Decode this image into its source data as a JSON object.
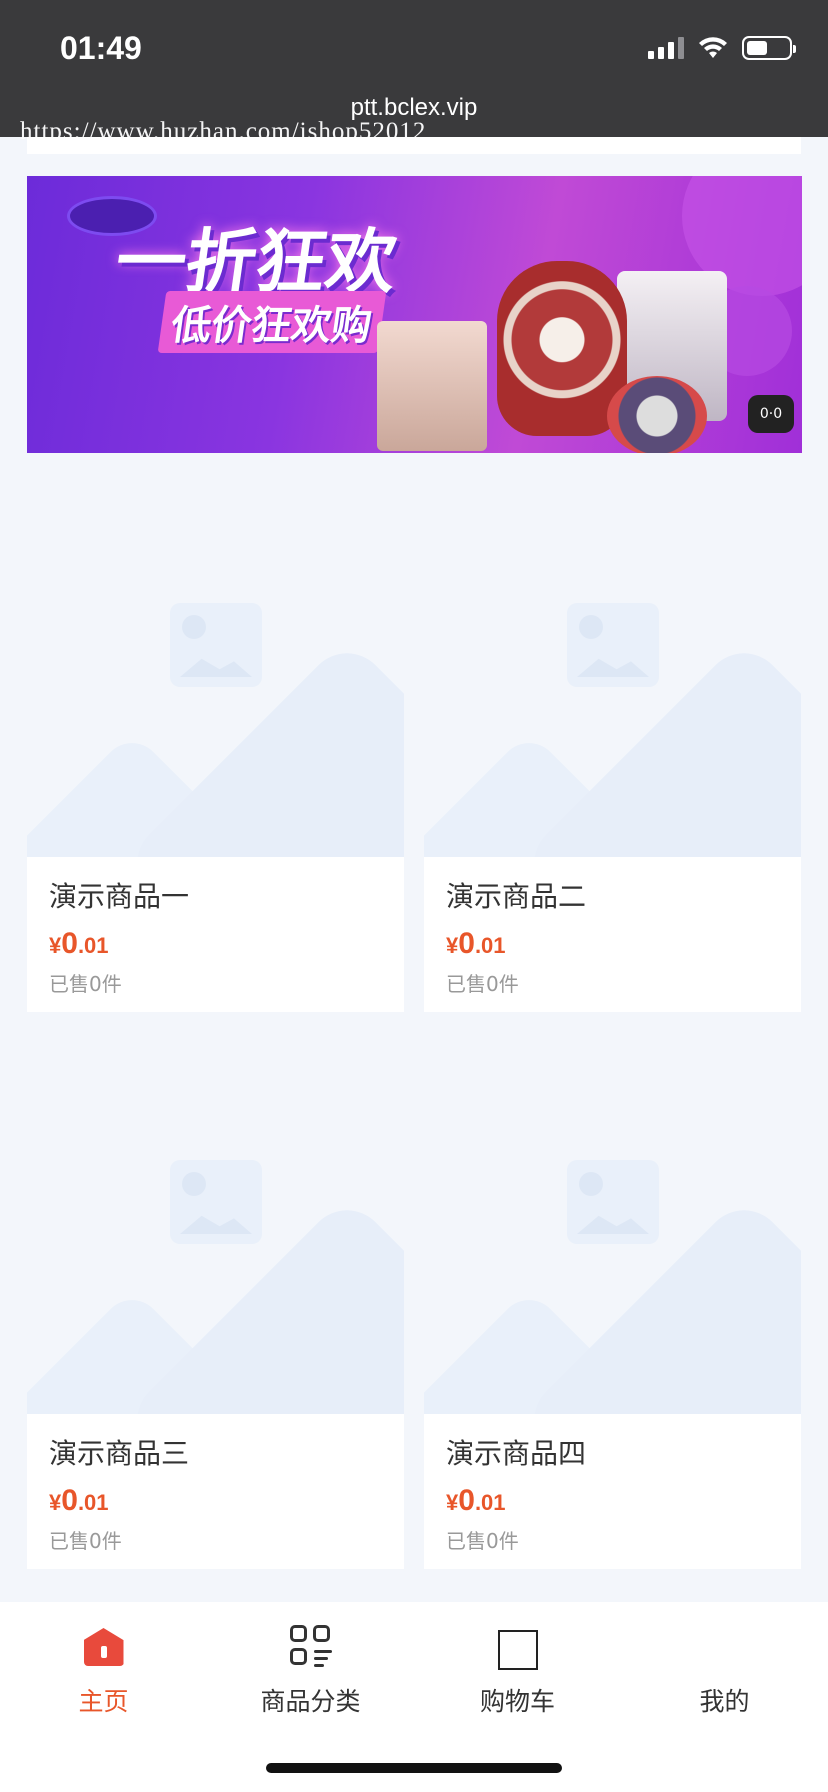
{
  "status_bar": {
    "time": "01:49",
    "url": "ptt.bclex.vip",
    "watermark": "https://www.huzhan.com/ishop52012"
  },
  "banner": {
    "title": "一折狂欢",
    "subtitle": "低价狂欢购",
    "badge": "0·0"
  },
  "products": [
    {
      "name": "演示商品一",
      "currency": "¥",
      "price_int": "0",
      "price_dec": ".01",
      "sold": "已售0件"
    },
    {
      "name": "演示商品二",
      "currency": "¥",
      "price_int": "0",
      "price_dec": ".01",
      "sold": "已售0件"
    },
    {
      "name": "演示商品三",
      "currency": "¥",
      "price_int": "0",
      "price_dec": ".01",
      "sold": "已售0件"
    },
    {
      "name": "演示商品四",
      "currency": "¥",
      "price_int": "0",
      "price_dec": ".01",
      "sold": "已售0件"
    }
  ],
  "tab_bar": {
    "items": [
      {
        "label": "主页",
        "icon": "home-icon",
        "active": true
      },
      {
        "label": "商品分类",
        "icon": "category-icon",
        "active": false
      },
      {
        "label": "购物车",
        "icon": "cart-icon",
        "active": false
      },
      {
        "label": "我的",
        "icon": "user-icon",
        "active": false
      }
    ]
  },
  "colors": {
    "accent": "#e8562a",
    "status_bar": "#3a3a3c",
    "page_bg": "#f3f6fb"
  }
}
